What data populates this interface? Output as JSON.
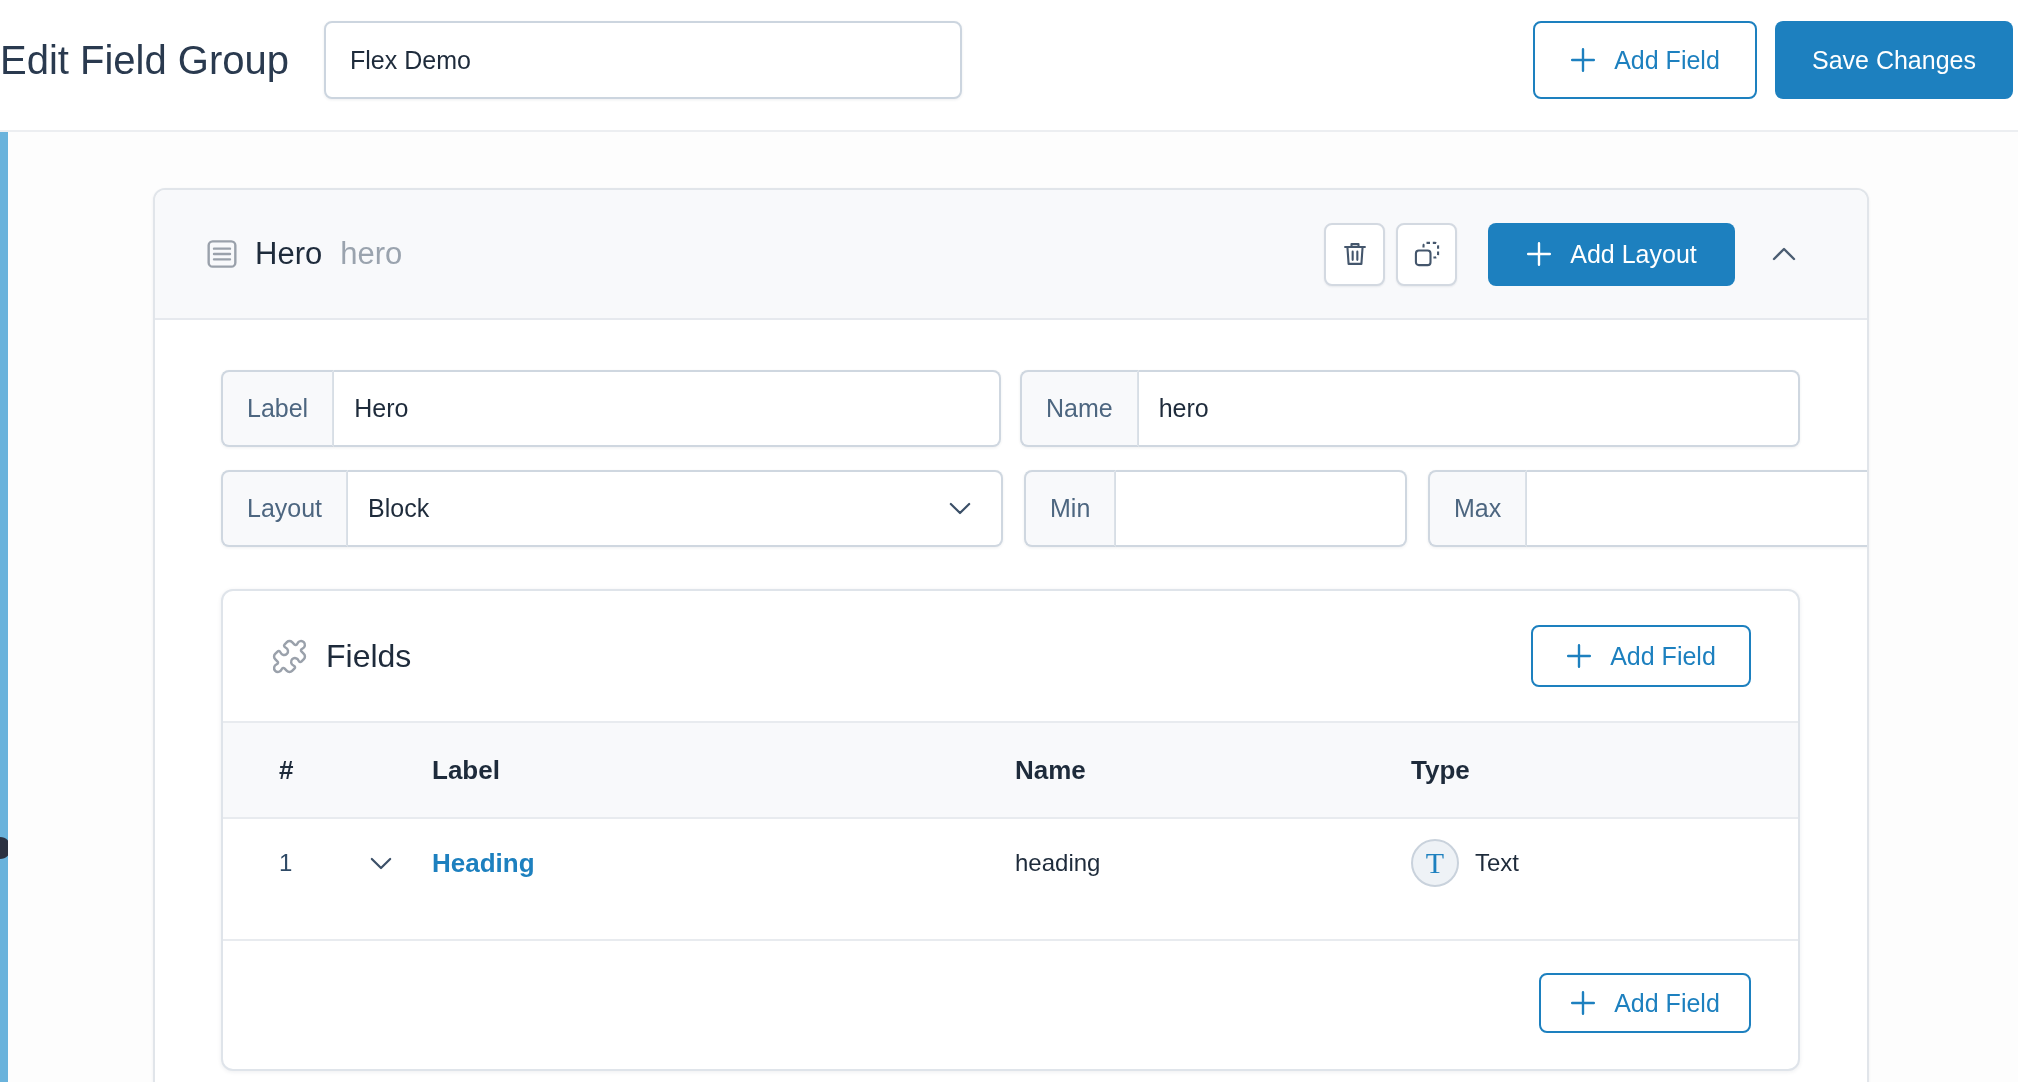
{
  "header": {
    "title": "Edit Field Group",
    "group_title": {
      "value": "Flex Demo"
    },
    "buttons": [
      {
        "label": "Add Field",
        "kind": "outline"
      },
      {
        "label": "Save Changes",
        "kind": "primary"
      }
    ]
  },
  "layout": {
    "label": "Hero",
    "name": "hero",
    "expanded": true,
    "add_button": "Add Layout",
    "settings": [
      [
        {
          "label": "Label",
          "kind": "text",
          "value": "Hero"
        },
        {
          "label": "Name",
          "kind": "text",
          "value": "hero"
        }
      ],
      [
        {
          "label": "Layout",
          "kind": "select",
          "value": "Block"
        },
        {
          "label": "Min",
          "kind": "number"
        },
        {
          "label": "Max",
          "kind": "number"
        }
      ]
    ],
    "fields": {
      "title": "Fields",
      "add_button": "Add Field",
      "columns": [
        "#",
        "Label",
        "Name",
        "Type"
      ],
      "rows": [
        {
          "number": "1",
          "expanded": false,
          "label": "Heading",
          "name": "heading",
          "type_icon": "T",
          "type": "Text"
        }
      ],
      "footer_button": "Add Field"
    }
  }
}
